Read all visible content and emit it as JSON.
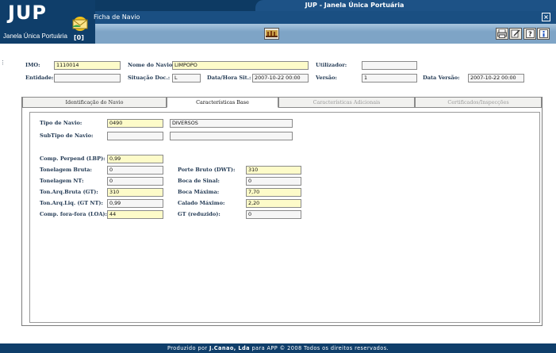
{
  "header": {
    "app_title": "JUP - Janela Única Portuária",
    "logo": "JUP",
    "logo_subtitle": "Janela Única Portuária",
    "mail_count": "[0]",
    "window_title": "Ficha de Navio",
    "close_icon": "close-icon",
    "toolbar_icons": [
      "ship-icon",
      "print-icon",
      "edit-icon",
      "help-icon",
      "info-icon"
    ]
  },
  "record": {
    "imo_label": "IMO:",
    "imo_value": "1110014",
    "nome_label": "Nome do Navio:",
    "nome_value": "LIMPOPO",
    "utilizador_label": "Utilizador:",
    "utilizador_value": "",
    "entidade_label": "Entidade:",
    "entidade_value": "",
    "situacao_label": "Situação Doc.:",
    "situacao_value": "L",
    "datahora_label": "Data/Hora Sit.:",
    "datahora_value": "2007-10-22 00:00",
    "versao_label": "Versão:",
    "versao_value": "1",
    "dataversao_label": "Data Versão:",
    "dataversao_value": "2007-10-22 00:00"
  },
  "tabs": [
    {
      "label": "Identificação do Navio",
      "state": "normal"
    },
    {
      "label": "Características Base",
      "state": "active"
    },
    {
      "label": "Características Adicionais",
      "state": "disabled"
    },
    {
      "label": "Certificados/Inspecções",
      "state": "disabled"
    }
  ],
  "base": {
    "tipo_label": "Tipo de Navio:",
    "tipo_code": "0490",
    "tipo_desc": "DIVERSOS",
    "subtipo_label": "SubTipo de Navio:",
    "subtipo_code": "",
    "subtipo_desc": "",
    "lbp_label": "Comp. Perpend (LBP):",
    "lbp_value": "0,99",
    "ton_bruta_label": "Tonelagem Bruta:",
    "ton_bruta_value": "0",
    "ton_nt_label": "Tonelagem NT:",
    "ton_nt_value": "0",
    "gt_label": "Ton.Arq.Bruta (GT):",
    "gt_value": "310",
    "gtnt_label": "Ton.Arq.Liq. (GT NT):",
    "gtnt_value": "0,99",
    "loa_label": "Comp. fora-fora (LOA):",
    "loa_value": "44",
    "dwt_label": "Porte Bruto (DWT):",
    "dwt_value": "310",
    "sinal_label": "Boca de Sinal:",
    "sinal_value": "0",
    "boca_label": "Boca Máxima:",
    "boca_value": "7,70",
    "calado_label": "Calado Máximo:",
    "calado_value": "2,20",
    "gtred_label": "GT (reduzido):",
    "gtred_value": "0"
  },
  "footer": {
    "prefix": "Produzido por",
    "company": "J.Canao, Lda",
    "suffix": "para APP © 2008 Todos os direitos reservados."
  }
}
